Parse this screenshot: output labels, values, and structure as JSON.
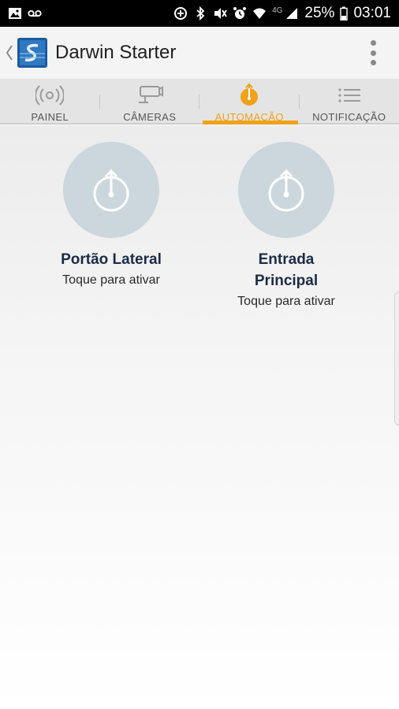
{
  "status_bar": {
    "network_label": "4G",
    "battery_percent": "25%",
    "time": "03:01",
    "icons": [
      "image-icon",
      "voicemail-icon",
      "data-saver-icon",
      "bluetooth-icon",
      "mute-icon",
      "alarm-icon",
      "wifi-icon",
      "signal-icon",
      "battery-icon"
    ]
  },
  "app_bar": {
    "title": "Darwin Starter",
    "icons": [
      "back-chevron-icon",
      "app-logo-icon",
      "overflow-menu-icon"
    ]
  },
  "tabs": [
    {
      "label": "PAINEL",
      "icon": "target-icon",
      "active": false
    },
    {
      "label": "CÂMERAS",
      "icon": "camera-icon",
      "active": false
    },
    {
      "label": "AUTOMAÇÃO",
      "icon": "power-icon",
      "active": true
    },
    {
      "label": "NOTIFICAÇÃO",
      "icon": "list-icon",
      "active": false
    }
  ],
  "devices": [
    {
      "name_line1": "Portão Lateral",
      "name_line2": "",
      "hint": "Toque para ativar",
      "icon": "power-icon"
    },
    {
      "name_line1": "Entrada",
      "name_line2": "Principal",
      "hint": "Toque para ativar",
      "icon": "power-icon"
    }
  ],
  "colors": {
    "accent": "#f0a21a",
    "circle": "#cbd7dd",
    "title_text": "#1b2c45",
    "status_bar": "#000000"
  }
}
